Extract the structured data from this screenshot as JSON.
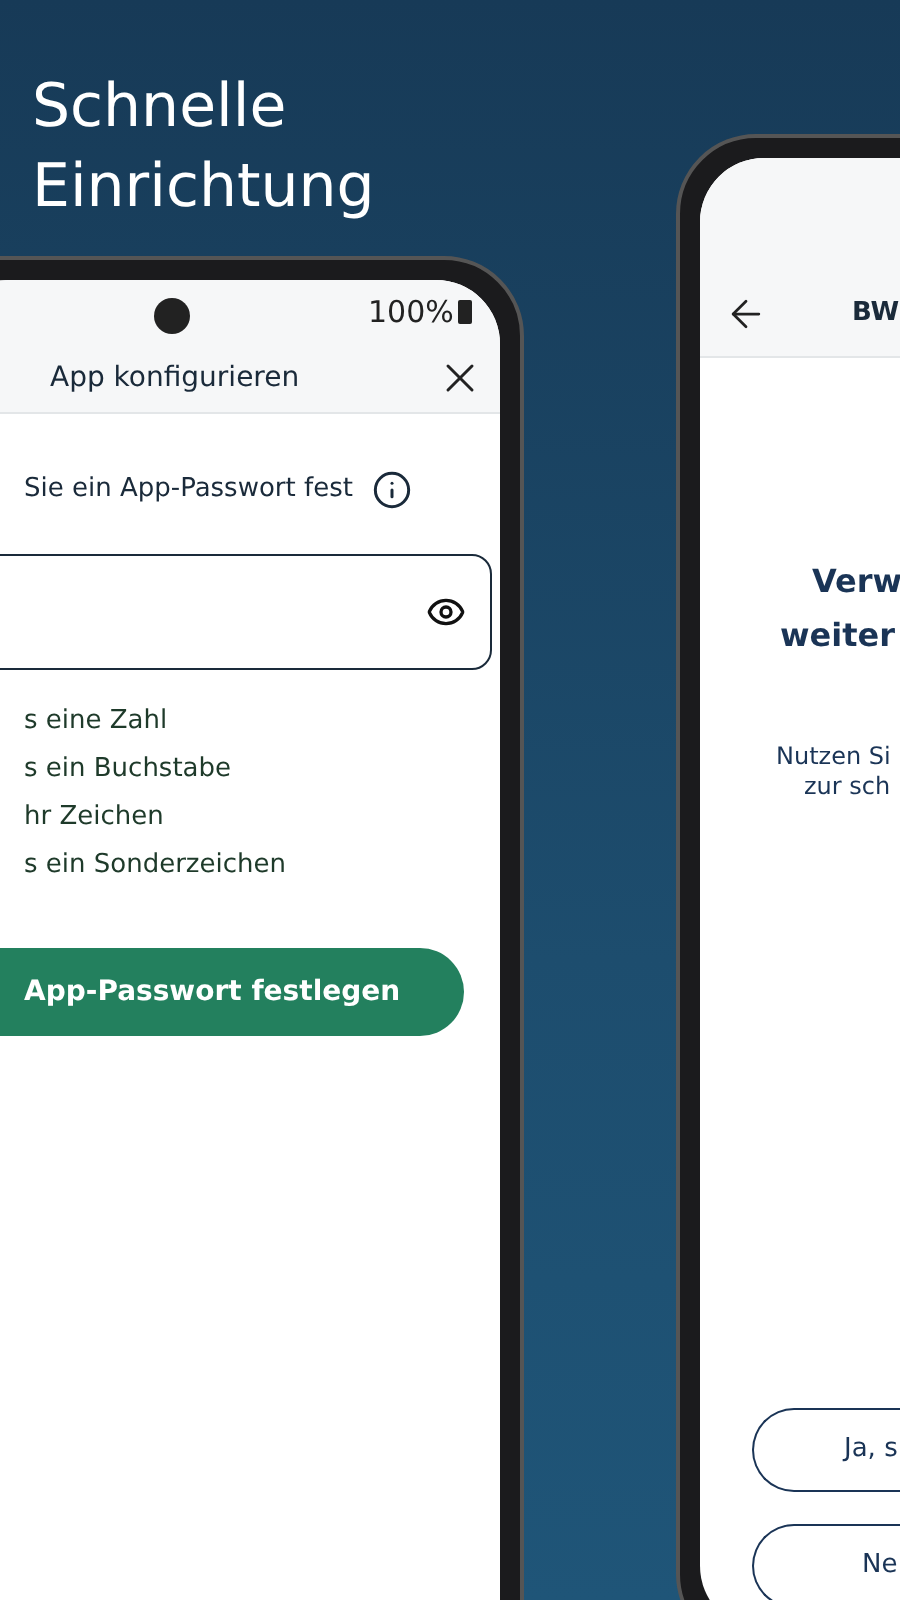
{
  "headline": [
    "Schnelle",
    "Einrichtung"
  ],
  "left_phone": {
    "status_bar": {
      "battery": "100%"
    },
    "header": {
      "title": "App konfigurieren"
    },
    "prompt": "Sie ein App-Passwort fest",
    "rules": [
      "s eine Zahl",
      "s ein Buchstabe",
      "hr Zeichen",
      "s ein Sonderzeichen"
    ],
    "submit_button": "App-Passwort festlegen"
  },
  "right_phone": {
    "header": {
      "title": "BW"
    },
    "heading": [
      "Verw",
      "weiter"
    ],
    "body": [
      "Nutzen Si",
      "zur sch"
    ],
    "buttons": [
      "Ja, s",
      "Ne"
    ]
  }
}
